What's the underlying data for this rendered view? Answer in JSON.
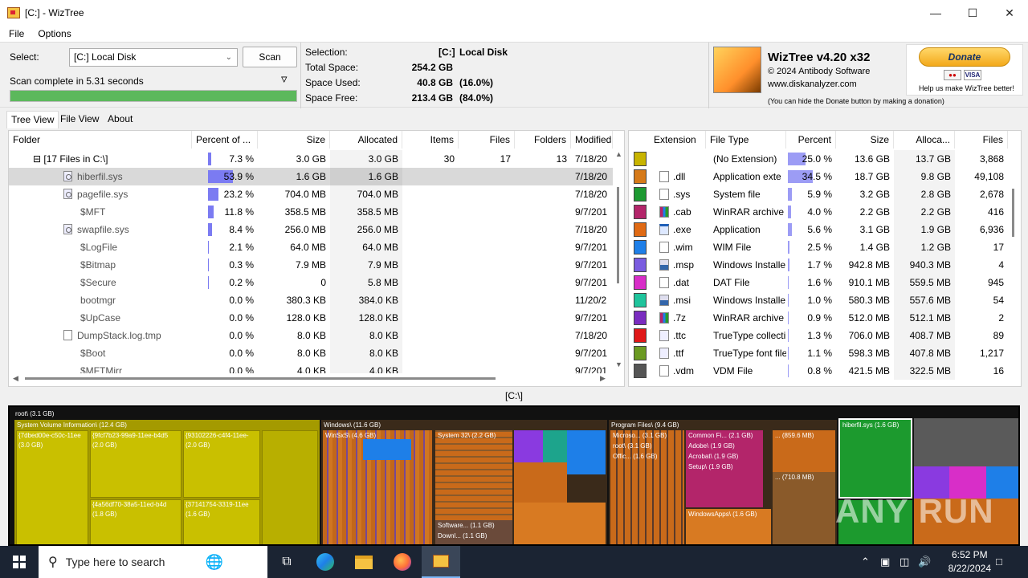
{
  "window": {
    "title": "[C:]  - WizTree"
  },
  "menu": [
    "File",
    "Options"
  ],
  "top": {
    "select_label": "Select:",
    "drive_value": "[C:] Local Disk",
    "scan_button": "Scan",
    "scan_status": "Scan complete in 5.31 seconds",
    "progress": 1.0,
    "selection_label": "Selection:",
    "selection_drive": "[C:]",
    "selection_name": "Local Disk",
    "total_label": "Total Space:",
    "total_value": "254.2 GB",
    "used_label": "Space Used:",
    "used_value": "40.8 GB",
    "used_pct": "(16.0%)",
    "free_label": "Space Free:",
    "free_value": "213.4 GB",
    "free_pct": "(84.0%)",
    "app_name": "WizTree v4.20 x32",
    "copyright": "© 2024 Antibody Software",
    "website": "www.diskanalyzer.com",
    "hide_note": "(You can hide the Donate button by making a donation)",
    "donate_button": "Donate",
    "donate_note": "Help us make WizTree better!"
  },
  "tabs": [
    "Tree View",
    "File View",
    "About"
  ],
  "tree": {
    "headers": [
      "Folder",
      "Percent of ...",
      "Size",
      "Allocated",
      "Items",
      "Files",
      "Folders",
      "Modified"
    ],
    "rows": [
      {
        "name": "[17 Files in C:\\]",
        "pct": "7.3 %",
        "pctv": 7.3,
        "size": "3.0 GB",
        "alloc": "3.0 GB",
        "items": "30",
        "files": "17",
        "folders": "13",
        "mod": "7/18/20",
        "icon": "none",
        "top": true
      },
      {
        "name": "hiberfil.sys",
        "pct": "53.9 %",
        "pctv": 53.9,
        "size": "1.6 GB",
        "alloc": "1.6 GB",
        "items": "",
        "files": "",
        "folders": "",
        "mod": "7/18/20",
        "icon": "sys",
        "selected": true
      },
      {
        "name": "pagefile.sys",
        "pct": "23.2 %",
        "pctv": 23.2,
        "size": "704.0 MB",
        "alloc": "704.0 MB",
        "items": "",
        "files": "",
        "folders": "",
        "mod": "7/18/20",
        "icon": "sys"
      },
      {
        "name": "$MFT",
        "pct": "11.8 %",
        "pctv": 11.8,
        "size": "358.5 MB",
        "alloc": "358.5 MB",
        "items": "",
        "files": "",
        "folders": "",
        "mod": "9/7/201",
        "icon": "none"
      },
      {
        "name": "swapfile.sys",
        "pct": "8.4 %",
        "pctv": 8.4,
        "size": "256.0 MB",
        "alloc": "256.0 MB",
        "items": "",
        "files": "",
        "folders": "",
        "mod": "7/18/20",
        "icon": "sys"
      },
      {
        "name": "$LogFile",
        "pct": "2.1 %",
        "pctv": 2.1,
        "size": "64.0 MB",
        "alloc": "64.0 MB",
        "items": "",
        "files": "",
        "folders": "",
        "mod": "9/7/201",
        "icon": "none"
      },
      {
        "name": "$Bitmap",
        "pct": "0.3 %",
        "pctv": 0.3,
        "size": "7.9 MB",
        "alloc": "7.9 MB",
        "items": "",
        "files": "",
        "folders": "",
        "mod": "9/7/201",
        "icon": "none"
      },
      {
        "name": "$Secure",
        "pct": "0.2 %",
        "pctv": 0.2,
        "size": "0",
        "alloc": "5.8 MB",
        "items": "",
        "files": "",
        "folders": "",
        "mod": "9/7/201",
        "icon": "none"
      },
      {
        "name": "bootmgr",
        "pct": "0.0 %",
        "pctv": 0,
        "size": "380.3 KB",
        "alloc": "384.0 KB",
        "items": "",
        "files": "",
        "folders": "",
        "mod": "11/20/2",
        "icon": "none"
      },
      {
        "name": "$UpCase",
        "pct": "0.0 %",
        "pctv": 0,
        "size": "128.0 KB",
        "alloc": "128.0 KB",
        "items": "",
        "files": "",
        "folders": "",
        "mod": "9/7/201",
        "icon": "none"
      },
      {
        "name": "DumpStack.log.tmp",
        "pct": "0.0 %",
        "pctv": 0,
        "size": "8.0 KB",
        "alloc": "8.0 KB",
        "items": "",
        "files": "",
        "folders": "",
        "mod": "7/18/20",
        "icon": "file"
      },
      {
        "name": "$Boot",
        "pct": "0.0 %",
        "pctv": 0,
        "size": "8.0 KB",
        "alloc": "8.0 KB",
        "items": "",
        "files": "",
        "folders": "",
        "mod": "9/7/201",
        "icon": "none"
      },
      {
        "name": "$MFTMirr",
        "pct": "0.0 %",
        "pctv": 0,
        "size": "4.0 KB",
        "alloc": "4.0 KB",
        "items": "",
        "files": "",
        "folders": "",
        "mod": "9/7/201",
        "icon": "none"
      }
    ]
  },
  "ext": {
    "headers": [
      "Extension",
      "File Type",
      "Percent",
      "Size",
      "Alloca...",
      "Files"
    ],
    "rows": [
      {
        "color": "#c8b400",
        "ext": "",
        "type": "(No Extension)",
        "pct": "25.0 %",
        "pctv": 25.0,
        "size": "13.6 GB",
        "alloc": "13.7 GB",
        "files": "3,868",
        "icon": "none"
      },
      {
        "color": "#d67a19",
        "ext": ".dll",
        "type": "Application exte",
        "pct": "34.5 %",
        "pctv": 34.5,
        "size": "18.7 GB",
        "alloc": "9.8 GB",
        "files": "49,108",
        "icon": "sys"
      },
      {
        "color": "#1d9a32",
        "ext": ".sys",
        "type": "System file",
        "pct": "5.9 %",
        "pctv": 5.9,
        "size": "3.2 GB",
        "alloc": "2.8 GB",
        "files": "2,678",
        "icon": "sys"
      },
      {
        "color": "#b3256a",
        "ext": ".cab",
        "type": "WinRAR archive",
        "pct": "4.0 %",
        "pctv": 4.0,
        "size": "2.2 GB",
        "alloc": "2.2 GB",
        "files": "416",
        "icon": "rar"
      },
      {
        "color": "#e06a14",
        "ext": ".exe",
        "type": "Application",
        "pct": "5.6 %",
        "pctv": 5.6,
        "size": "3.1 GB",
        "alloc": "1.9 GB",
        "files": "6,936",
        "icon": "app"
      },
      {
        "color": "#1e7fe8",
        "ext": ".wim",
        "type": "WIM File",
        "pct": "2.5 %",
        "pctv": 2.5,
        "size": "1.4 GB",
        "alloc": "1.2 GB",
        "files": "17",
        "icon": "file"
      },
      {
        "color": "#7a5ce0",
        "ext": ".msp",
        "type": "Windows Installe",
        "pct": "1.7 %",
        "pctv": 1.7,
        "size": "942.8 MB",
        "alloc": "940.3 MB",
        "files": "4",
        "icon": "msi"
      },
      {
        "color": "#d82ec8",
        "ext": ".dat",
        "type": "DAT File",
        "pct": "1.6 %",
        "pctv": 1.6,
        "size": "910.1 MB",
        "alloc": "559.5 MB",
        "files": "945",
        "icon": "file"
      },
      {
        "color": "#1fc49c",
        "ext": ".msi",
        "type": "Windows Installe",
        "pct": "1.0 %",
        "pctv": 1.0,
        "size": "580.3 MB",
        "alloc": "557.6 MB",
        "files": "54",
        "icon": "msi"
      },
      {
        "color": "#7a2cc0",
        "ext": ".7z",
        "type": "WinRAR archive",
        "pct": "0.9 %",
        "pctv": 0.9,
        "size": "512.0 MB",
        "alloc": "512.1 MB",
        "files": "2",
        "icon": "rar"
      },
      {
        "color": "#e01818",
        "ext": ".ttc",
        "type": "TrueType collecti",
        "pct": "1.3 %",
        "pctv": 1.3,
        "size": "706.0 MB",
        "alloc": "408.7 MB",
        "files": "89",
        "icon": "font"
      },
      {
        "color": "#6b9a22",
        "ext": ".ttf",
        "type": "TrueType font file",
        "pct": "1.1 %",
        "pctv": 1.1,
        "size": "598.3 MB",
        "alloc": "407.8 MB",
        "files": "1,217",
        "icon": "font"
      },
      {
        "color": "#555555",
        "ext": ".vdm",
        "type": "VDM File",
        "pct": "0.8 %",
        "pctv": 0.8,
        "size": "421.5 MB",
        "alloc": "322.5 MB",
        "files": "16",
        "icon": "file"
      }
    ]
  },
  "path_label": "[C:\\]",
  "treemap": {
    "labels": {
      "root": "root\\  (3.1 GB)",
      "svi": "System Volume Information\\  (12.4 GB)",
      "b1": "{7dbed00e-c50c-11ee",
      "b1s": "(3.0 GB)",
      "b2": "{9fcf7b23-99a9-11ee-b4d5",
      "b2s": "(2.0 GB)",
      "b3": "{93102226-c4f4-11ee-",
      "b3s": "(2.0 GB)",
      "b4": "{4a56df70-38a5-11ed-b4d",
      "b4s": "(1.8 GB)",
      "b5": "{37141754-3319-11ee",
      "b5s": "(1.6 GB)",
      "windows": "Windows\\  (11.6 GB)",
      "winsxs": "WinSxS\\  (4.6 GB)",
      "system32": "System 32\\  (2.2 GB)",
      "software": "Software...  (1.1 GB)",
      "downl": "Downl...  (1.1 GB)",
      "progfiles": "Program Files\\  (9.4 GB)",
      "microso": "Microso...  (3.1 GB)",
      "offic": "Offic...  (1.6 GB)",
      "commonfi": "Common Fi...  (2.1 GB)",
      "adobe": "Adobe\\  (1.9 GB)",
      "acrobat": "Acrobat\\  (1.9 GB)",
      "setup": "Setup\\  (1.9 GB)",
      "winapps": "WindowsApps\\  (1.6 GB)",
      "d1": "...  (859.6 MB)",
      "d2": "...  (710.8 MB)",
      "hiberfil": "hiberfil.sys  (1.6 GB)"
    }
  },
  "taskbar": {
    "search_placeholder": "Type here to search",
    "time": "6:52 PM",
    "date": "8/22/2024"
  },
  "watermark": "ANY RUN"
}
